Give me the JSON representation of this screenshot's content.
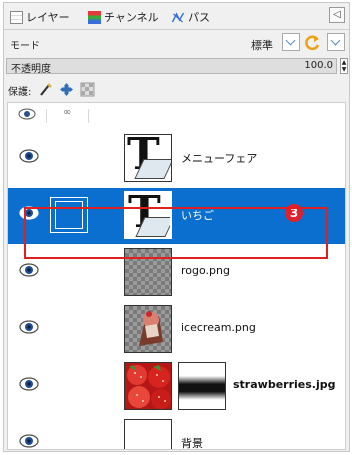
{
  "tabs": [
    {
      "label": "レイヤー",
      "icon": "layers-icon"
    },
    {
      "label": "チャンネル",
      "icon": "channels-icon"
    },
    {
      "label": "パス",
      "icon": "paths-icon"
    }
  ],
  "mode": {
    "label": "モード",
    "value": "標準"
  },
  "opacity": {
    "label": "不透明度",
    "value": "100.0"
  },
  "lock": {
    "label": "保護:"
  },
  "badge": "3",
  "layers": [
    {
      "name": "メニューフェア",
      "thumbnail": "text-layer",
      "selected": false
    },
    {
      "name": "いちご",
      "thumbnail": "text-layer",
      "selected": true
    },
    {
      "name": "rogo.png",
      "thumbnail": "transparent-checker",
      "selected": false
    },
    {
      "name": "icecream.png",
      "thumbnail": "icecream-image",
      "selected": false
    },
    {
      "name": "strawberries.jpg",
      "thumbnail": "strawberries-image",
      "mask": true,
      "selected": false
    },
    {
      "name": "背景",
      "thumbnail": "white-background",
      "selected": false
    }
  ],
  "colors": {
    "selection": "#0a6fcf",
    "highlight": "#e02020",
    "badge": "#e0202a"
  }
}
